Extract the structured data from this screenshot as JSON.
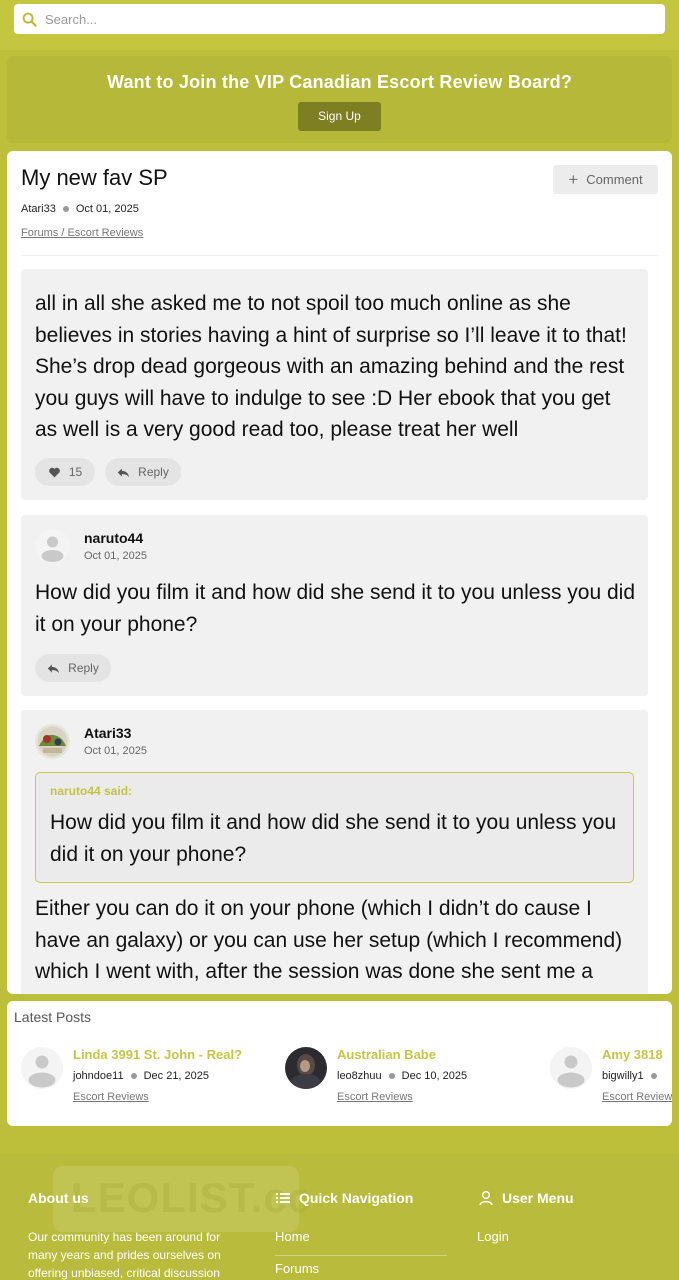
{
  "header": {
    "search_placeholder": "Search..."
  },
  "banner": {
    "title": "Want to Join the VIP Canadian Escort Review Board?",
    "signup_label": "Sign Up"
  },
  "thread": {
    "title": "My new fav SP",
    "comment_label": "Comment",
    "author": "Atari33",
    "date": "Oct 01, 2025",
    "breadcrumb": "Forums / Escort Reviews"
  },
  "posts": [
    {
      "body": "all in all she asked me to not spoil too much online as she believes in stories having a hint of surprise so I’ll leave it to that! She’s drop dead gorgeous with an amazing behind and the rest you guys will have to indulge to see :D Her ebook that you get as well is a very good read too, please treat her well",
      "likes": "15",
      "reply_label": "Reply"
    },
    {
      "author": "naruto44",
      "date": "Oct 01, 2025",
      "body": "How did you film it and how did she send it to you unless you did it on your phone?",
      "reply_label": "Reply"
    },
    {
      "author": "Atari33",
      "date": "Oct 01, 2025",
      "quote_head": "naruto44 said:",
      "quote_body": "How did you film it and how did she send it to you unless you did it on your phone?",
      "body": "Either you can do it on your phone (which I didn’t do cause I have an galaxy) or you can use her setup (which I recommend) which I went with, after the session was done she sent me a google drive"
    }
  ],
  "latest": {
    "title": "Latest Posts",
    "items": [
      {
        "title": "Linda 3991 St. John - Real?",
        "author": "johndoe11",
        "date": "Dec 21, 2025",
        "category": "Escort Reviews"
      },
      {
        "title": "Australian Babe",
        "author": "leo8zhuu",
        "date": "Dec 10, 2025",
        "category": "Escort Reviews"
      },
      {
        "title": "Amy 3818",
        "author": "bigwilly1",
        "date": "",
        "category": "Escort Reviews"
      }
    ]
  },
  "footer": {
    "watermark": "LEOLIST.cc",
    "about_title": "About us",
    "about_text": "Our community has been around for many years and prides ourselves on offering unbiased, critical discussion",
    "quicknav_title": "Quick Navigation",
    "quicknav_links": [
      "Home",
      "Forums"
    ],
    "usermenu_title": "User Menu",
    "usermenu_links": [
      "Login"
    ]
  },
  "colors": {
    "accent": "#c4c648",
    "banner": "#b6b83a",
    "button_dark": "#7e7f22"
  }
}
